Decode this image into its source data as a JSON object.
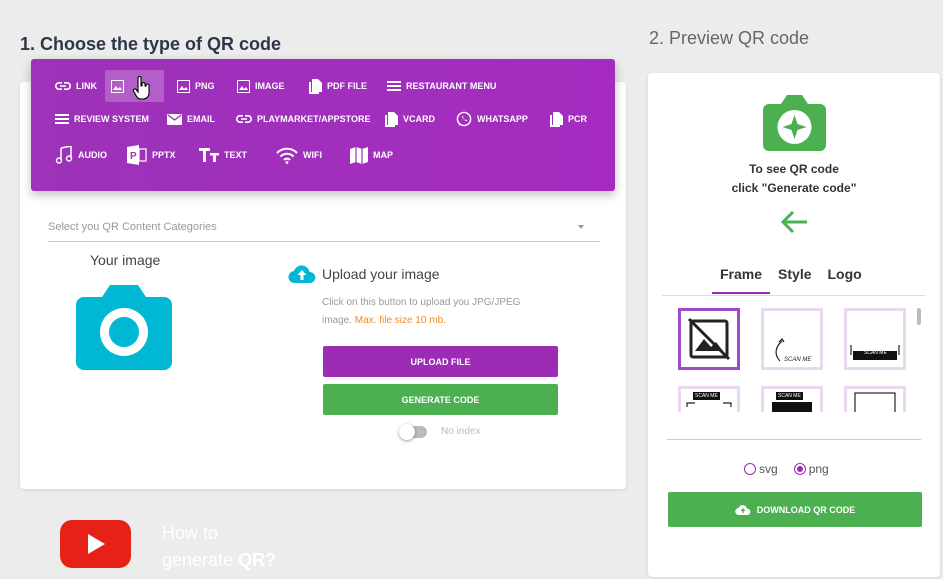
{
  "left": {
    "title": "1. Choose the type of QR code",
    "types": [
      {
        "label": "LINK",
        "icon": "link-icon"
      },
      {
        "label": "",
        "icon": "image-icon"
      },
      {
        "label": "PNG",
        "icon": "image-icon"
      },
      {
        "label": "IMAGE",
        "icon": "image-icon"
      },
      {
        "label": "PDF FILE",
        "icon": "file-copy-icon"
      },
      {
        "label": "RESTAURANT MENU",
        "icon": "menu-lines-icon"
      },
      {
        "label": "REVIEW SYSTEM",
        "icon": "menu-lines-icon"
      },
      {
        "label": "EMAIL",
        "icon": "mail-icon"
      },
      {
        "label": "PLAYMARKET/APPSTORE",
        "icon": "link-icon"
      },
      {
        "label": "VCARD",
        "icon": "file-copy-icon"
      },
      {
        "label": "WHATSAPP",
        "icon": "whatsapp-icon"
      },
      {
        "label": "PCR",
        "icon": "file-copy-icon"
      },
      {
        "label": "AUDIO",
        "icon": "music-note-icon"
      },
      {
        "label": "PPTX",
        "icon": "powerpoint-icon"
      },
      {
        "label": "TEXT",
        "icon": "text-format-icon"
      },
      {
        "label": "WIFI",
        "icon": "wifi-icon"
      },
      {
        "label": "MAP",
        "icon": "map-icon"
      }
    ],
    "select_placeholder": "Select you QR Content Categories",
    "your_image": "Your image",
    "upload_title": "Upload your image",
    "upload_desc": "Click on this button to upload you JPG/JPEG image.",
    "upload_warn": "Max. file size 10 mb.",
    "upload_button": "UPLOAD FILE",
    "generate_button": "GENERATE CODE",
    "toggle_label": "No index",
    "how_to_line1": "How to",
    "how_to_line2a": "generate ",
    "how_to_line2b": "QR?"
  },
  "right": {
    "title": "2. Preview QR code",
    "preview_line1": "To see QR code",
    "preview_line2": "click \"Generate code\"",
    "tabs": [
      "Frame",
      "Style",
      "Logo"
    ],
    "frame_labels": [
      "SCAN ME",
      "SCAN ME",
      "SCAN ME",
      "SCAN ME"
    ],
    "format_svg": "svg",
    "format_png": "png",
    "download_button": "DOWNLOAD QR CODE"
  },
  "colors": {
    "purple": "#9c2bb5",
    "green": "#4caf50",
    "teal": "#00b8d4",
    "youtube": "#e62117"
  }
}
